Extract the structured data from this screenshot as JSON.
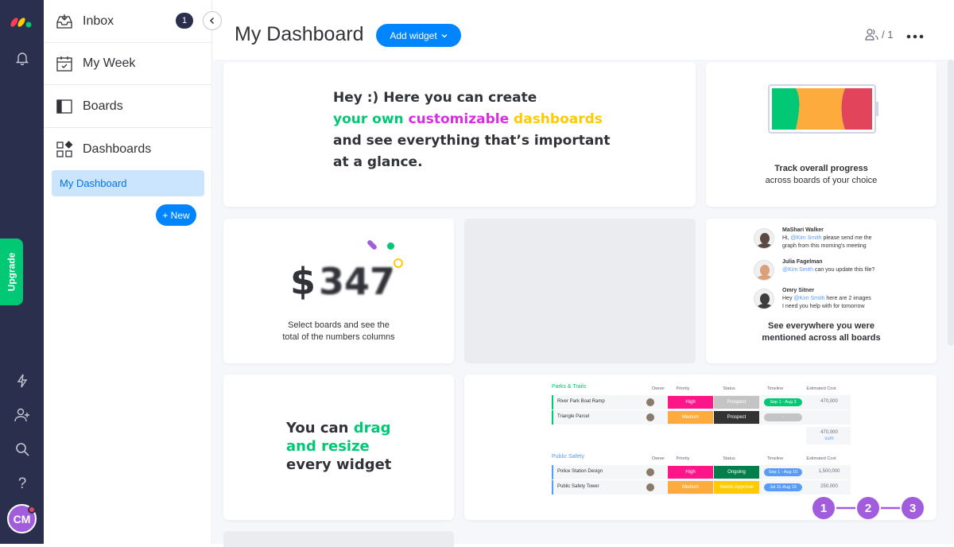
{
  "sidebar": {
    "inbox": {
      "label": "Inbox",
      "count": "1"
    },
    "my_week": "My Week",
    "boards": "Boards",
    "dashboards": "Dashboards",
    "active_item": "My Dashboard",
    "new_button": "+ New"
  },
  "rail": {
    "upgrade": "Upgrade",
    "avatar_initials": "CM"
  },
  "header": {
    "title": "My Dashboard",
    "add_widget": "Add widget",
    "members": "/ 1"
  },
  "widgets": {
    "intro": {
      "line1": "Hey :) Here you can create",
      "line2_a": "your own",
      "line2_b": "customizable",
      "line2_c": "dashboards",
      "line3": "and see everything that’s important",
      "line4": "at a glance."
    },
    "progress": {
      "line1": "Track overall progress",
      "line2": "across boards of your choice"
    },
    "numbers": {
      "dollar": "$",
      "digits": "347",
      "line1": "Select boards and see the",
      "line2": "total of the numbers columns"
    },
    "mentions": {
      "items": [
        {
          "name": "MaShari Walker",
          "text1_pre": "Hi, ",
          "mention": "@Kim Smith",
          "text1_post": " please send me the",
          "text2": "graph from this morning's meeting"
        },
        {
          "name": "Julia Fagelman",
          "text1_pre": "",
          "mention": "@Kim Smith",
          "text1_post": " can you update this file?",
          "text2": ""
        },
        {
          "name": "Omry Sitner",
          "text1_pre": "Hey ",
          "mention": "@Kim Smith",
          "text1_post": " here are 2 images",
          "text2": "I need you help with for tomorrow"
        }
      ],
      "caption1": "See everywhere you were",
      "caption2": "mentioned across all boards"
    },
    "drag": {
      "w1": "You can",
      "w2": "drag",
      "w3": "and resize",
      "w4": "every widget"
    },
    "table": {
      "groups": [
        {
          "name": "Parks & Trails",
          "color": "#00c875",
          "headers": [
            "Owner",
            "Priority",
            "Status",
            "Timeline",
            "Estimated Cost"
          ],
          "rows": [
            {
              "item": "River Park Boat Ramp",
              "priority": "High",
              "priority_color": "#ff158a",
              "status": "Prospect",
              "status_color": "#c4c4c4",
              "timeline": "Sep 1 - Aug 3",
              "timeline_color": "#00c875",
              "cost": "470,000"
            },
            {
              "item": "Triangle Parcel",
              "priority": "Medium",
              "priority_color": "#fdab3d",
              "status": "Prospect",
              "status_color": "#333333",
              "timeline": "-",
              "timeline_color": "#c4c4c4",
              "cost": ""
            }
          ],
          "sum_value": "470,000",
          "sum_label": "sum"
        },
        {
          "name": "Public Safety",
          "color": "#579bfc",
          "headers": [
            "Owner",
            "Priority",
            "Status",
            "Timeline",
            "Estimated Cost"
          ],
          "rows": [
            {
              "item": "Police Station Design",
              "priority": "High",
              "priority_color": "#ff158a",
              "status": "Ongoing",
              "status_color": "#037f4c",
              "timeline": "Sep 1 - Aug 10",
              "timeline_color": "#579bfc",
              "cost": "1,500,000"
            },
            {
              "item": "Public Safety Tower",
              "priority": "Medium",
              "priority_color": "#fdab3d",
              "status": "Needs Approval",
              "status_color": "#ffcb00",
              "timeline": "Jul 11-Aug 19",
              "timeline_color": "#579bfc",
              "cost": "250,000"
            }
          ],
          "sum_value": "",
          "sum_label": ""
        }
      ],
      "steps": [
        "1",
        "2",
        "3"
      ]
    }
  },
  "colors": {
    "brand_blue": "#0085ff",
    "green": "#00c875",
    "purple": "#a25ddc",
    "yellow": "#ffcb00",
    "magenta": "#e040e0"
  }
}
